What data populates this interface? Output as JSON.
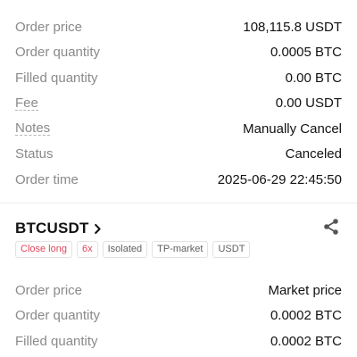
{
  "first_order": {
    "rows": [
      {
        "label": "Order price",
        "value": "108,115.8 USDT"
      },
      {
        "label": "Order quantity",
        "value": "0.0005 BTC"
      },
      {
        "label": "Filled quantity",
        "value": "0.00 BTC"
      },
      {
        "label": "Fee",
        "value": "0.00 USDT"
      },
      {
        "label": "Notes",
        "value": "Manually Cancel"
      },
      {
        "label": "Status",
        "value": "Canceled"
      },
      {
        "label": "Order time",
        "value": "2025-06-29 22:45:50"
      }
    ]
  },
  "second_order": {
    "symbol": "BTCUSDT",
    "tags": {
      "side": "Close long",
      "leverage": "6x",
      "margin_mode": "Isolated",
      "order_type": "TP-market",
      "settle": "USDT"
    },
    "rows": [
      {
        "label": "Order price",
        "value": "Market price"
      },
      {
        "label": "Order quantity",
        "value": "0.0002 BTC"
      },
      {
        "label": "Filled quantity",
        "value": "0.0002 BTC"
      }
    ]
  },
  "colors": {
    "label_gray": "#8a8a8a",
    "value_text": "#121212",
    "accent_red": "#e0455a",
    "tag_border": "#e3e3e3"
  },
  "icons": {
    "symbol_chevron": "chevron-right-icon",
    "share": "share-icon"
  }
}
